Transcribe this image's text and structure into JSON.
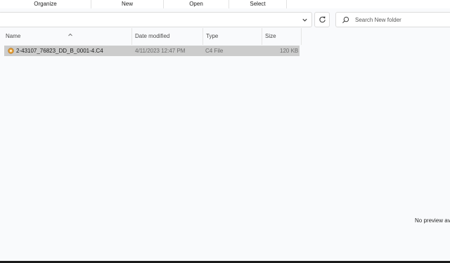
{
  "ribbon": {
    "groups": [
      "Organize",
      "New",
      "Open",
      "Select"
    ]
  },
  "address_bar": {
    "path": ""
  },
  "search": {
    "placeholder": "Search New folder"
  },
  "columns": {
    "name": "Name",
    "date_modified": "Date modified",
    "type": "Type",
    "size": "Size",
    "sort_column": "Name",
    "sort_direction": "ascending"
  },
  "files": [
    {
      "name": "2-43107_76823_DD_B_0001-4.C4",
      "date_modified": "4/11/2023 12:47 PM",
      "type": "C4 File",
      "size": "120 KB",
      "selected": true
    }
  ],
  "preview": {
    "message": "No preview av"
  },
  "colors": {
    "background": "#f9fafc",
    "selection": "#cccccc",
    "file_icon": "#e8a13a"
  },
  "icons": {
    "address_dropdown": "chevron-down-icon",
    "refresh": "refresh-icon",
    "search": "search-icon",
    "sort": "sort-ascending-icon",
    "file": "c4-file-icon"
  }
}
